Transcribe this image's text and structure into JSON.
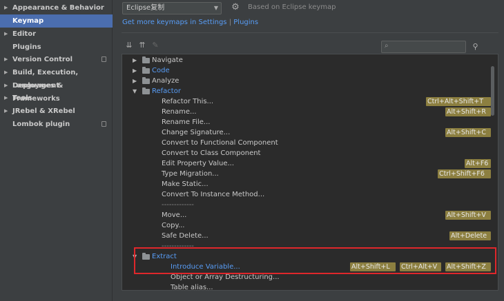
{
  "sidebar": {
    "items": [
      {
        "label": "Appearance & Behavior",
        "expandable": true
      },
      {
        "label": "Keymap",
        "selected": true
      },
      {
        "label": "Editor",
        "expandable": true
      },
      {
        "label": "Plugins"
      },
      {
        "label": "Version Control",
        "expandable": true,
        "config_icon": true
      },
      {
        "label": "Build, Execution, Deployment",
        "expandable": true
      },
      {
        "label": "Languages & Frameworks",
        "expandable": true
      },
      {
        "label": "Tools",
        "expandable": true
      },
      {
        "label": "JRebel & XRebel",
        "expandable": true
      },
      {
        "label": "Lombok plugin",
        "config_icon": true
      }
    ]
  },
  "header": {
    "keymap_value": "Eclipse复制",
    "based_on": "Based on Eclipse keymap",
    "more_keymaps_prefix": "Get more keymaps in Settings",
    "separator": "|",
    "plugins_link": "Plugins"
  },
  "toolbar": {
    "expand_all_icon": "expand-all-icon",
    "collapse_all_icon": "collapse-all-icon",
    "edit_icon": "pencil-icon",
    "search_placeholder": "",
    "find_shortcut_icon": "find-by-shortcut-icon"
  },
  "tree": {
    "rows": [
      {
        "label": "Navigate",
        "level": 0,
        "folder": true,
        "expanded": false,
        "shortcuts": []
      },
      {
        "label": "Code",
        "level": 0,
        "folder": true,
        "expanded": false,
        "blue": true,
        "shortcuts": []
      },
      {
        "label": "Analyze",
        "level": 0,
        "folder": true,
        "expanded": false,
        "shortcuts": []
      },
      {
        "label": "Refactor",
        "level": 0,
        "folder": true,
        "expanded": true,
        "blue": true,
        "shortcuts": []
      },
      {
        "label": "Refactor This...",
        "level": 1,
        "shortcuts": [
          "Ctrl+Alt+Shift+T"
        ]
      },
      {
        "label": "Rename...",
        "level": 1,
        "shortcuts": [
          "Alt+Shift+R"
        ]
      },
      {
        "label": "Rename File...",
        "level": 1,
        "shortcuts": []
      },
      {
        "label": "Change Signature...",
        "level": 1,
        "shortcuts": [
          "Alt+Shift+C"
        ]
      },
      {
        "label": "Convert to Functional Component",
        "level": 1,
        "shortcuts": []
      },
      {
        "label": "Convert to Class Component",
        "level": 1,
        "shortcuts": []
      },
      {
        "label": "Edit Property Value...",
        "level": 1,
        "shortcuts": [
          "Alt+F6"
        ]
      },
      {
        "label": "Type Migration...",
        "level": 1,
        "shortcuts": [
          "Ctrl+Shift+F6"
        ]
      },
      {
        "label": "Make Static...",
        "level": 1,
        "shortcuts": []
      },
      {
        "label": "Convert To Instance Method...",
        "level": 1,
        "shortcuts": []
      },
      {
        "label": "-------------",
        "level": 1,
        "separator": true,
        "shortcuts": []
      },
      {
        "label": "Move...",
        "level": 1,
        "shortcuts": [
          "Alt+Shift+V"
        ]
      },
      {
        "label": "Copy...",
        "level": 1,
        "shortcuts": []
      },
      {
        "label": "Safe Delete...",
        "level": 1,
        "shortcuts": [
          "Alt+Delete"
        ]
      },
      {
        "label": "-------------",
        "level": 1,
        "separator": true,
        "shortcuts": []
      },
      {
        "label": "Extract",
        "level": 1,
        "folder": true,
        "expanded": true,
        "blue": true,
        "shortcuts": []
      },
      {
        "label": "Introduce Variable...",
        "level": 2,
        "blue": true,
        "shortcuts": [
          "Alt+Shift+L",
          "Ctrl+Alt+V",
          "Alt+Shift+Z"
        ]
      },
      {
        "label": "Object or Array Destructuring...",
        "level": 2,
        "shortcuts": []
      },
      {
        "label": "Table alias...",
        "level": 2,
        "shortcuts": []
      }
    ]
  },
  "colors": {
    "selection": "#4b6eaf",
    "link": "#589df6",
    "shortcut_badge": "#8c7f40",
    "annotation_box": "#e0272b"
  }
}
